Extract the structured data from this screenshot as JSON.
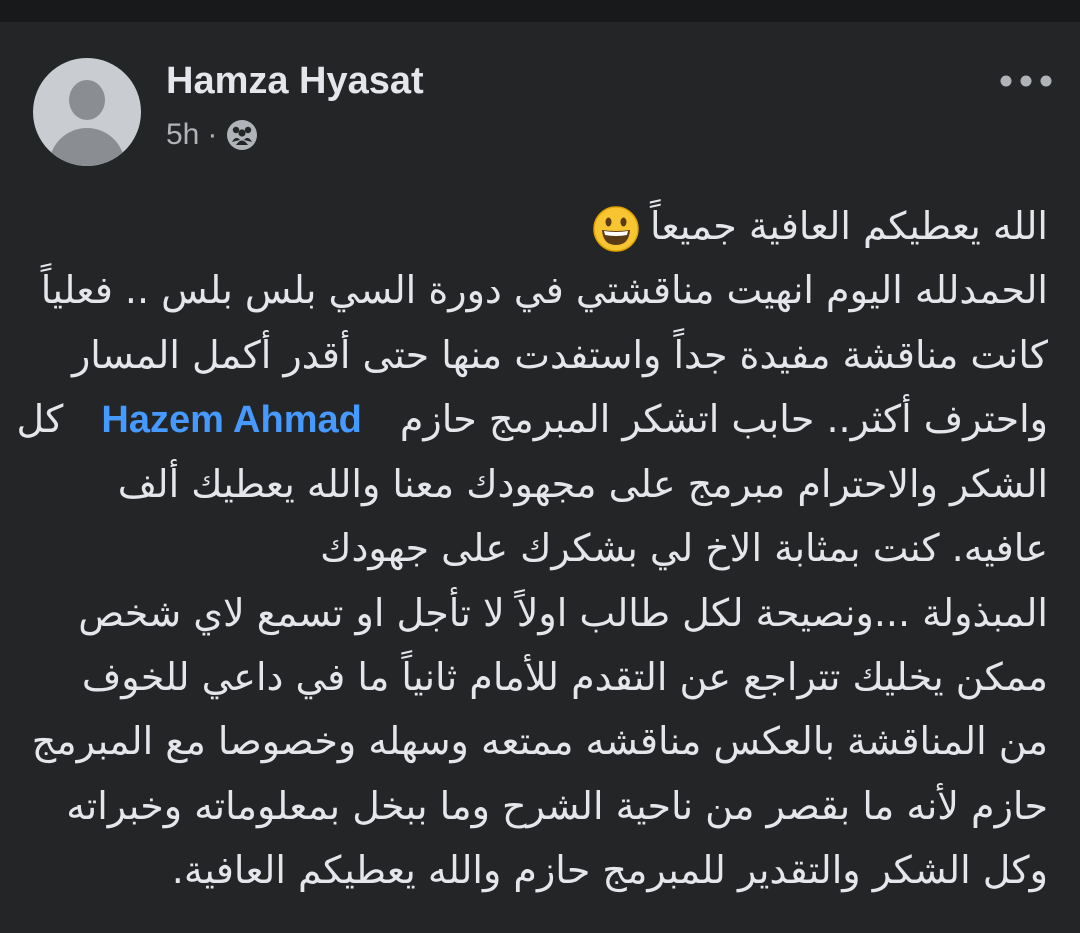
{
  "post": {
    "author_name": "Hamza Hyasat",
    "timestamp": "5h",
    "separator": "·",
    "privacy_icon": "friends-icon",
    "more_icon": "more-horizontal-icon",
    "emoji_icon": "grinning-face-emoji",
    "text": {
      "line1": "الله يعطيكم العافية جميعاً",
      "line2": "الحمدلله اليوم انهيت مناقشتي في دورة السي بلس بلس .. فعلياً",
      "line3": "كانت مناقشة مفيدة جداً واستفدت منها حتى أقدر أكمل المسار",
      "line4_before": "واحترف أكثر.. حابب اتشكر المبرمج حازم",
      "mention": "Hazem Ahmad",
      "line4_after": "كل",
      "line5": "الشكر والاحترام مبرمج على مجهودك معنا والله يعطيك ألف",
      "line6": "عافيه. كنت بمثابة الاخ لي بشكرك على جهودك",
      "line7": "المبذولة ...ونصيحة لكل طالب اولاً لا تأجل او تسمع لاي شخص",
      "line8": "ممكن يخليك تتراجع عن التقدم للأمام ثانياً ما في داعي للخوف",
      "line9": "من المناقشة بالعكس مناقشه ممتعه وسهله وخصوصا مع المبرمج",
      "line10": "حازم لأنه ما بقصر من ناحية الشرح وما ببخل بمعلوماته وخبراته",
      "line11": "وكل الشكر والتقدير للمبرمج حازم والله يعطيكم العافية."
    }
  }
}
